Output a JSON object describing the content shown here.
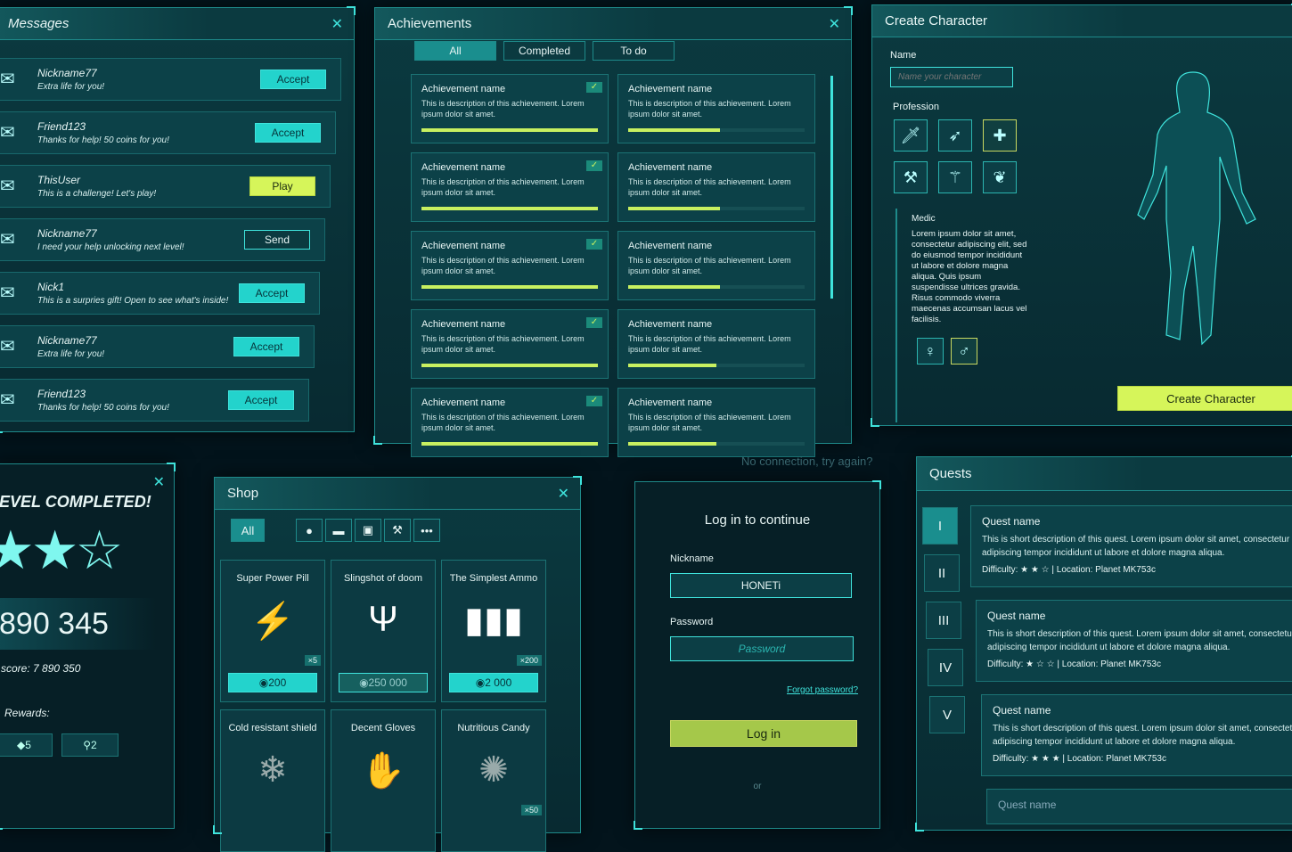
{
  "colors": {
    "accent": "#3fe3dc",
    "lime": "#d6f55a",
    "bg": "#03141c"
  },
  "messages": {
    "title": "Messages",
    "items": [
      {
        "name": "Nickname77",
        "text": "Extra life for you!",
        "button": "Accept",
        "style": "cyan",
        "icon": "heart-envelope-icon"
      },
      {
        "name": "Friend123",
        "text": "Thanks for help! 50 coins for you!",
        "button": "Accept",
        "style": "cyan",
        "icon": "coin-envelope-icon"
      },
      {
        "name": "ThisUser",
        "text": "This is a challenge! Let's play!",
        "button": "Play",
        "style": "lime",
        "icon": "sword-envelope-icon"
      },
      {
        "name": "Nickname77",
        "text": "I need your help unlocking next level!",
        "button": "Send",
        "style": "dark",
        "icon": "envelope-icon"
      },
      {
        "name": "Nick1",
        "text": "This is a surpries gift! Open to see what's inside!",
        "button": "Accept",
        "style": "cyan",
        "icon": "gift-envelope-icon"
      },
      {
        "name": "Nickname77",
        "text": "Extra life for you!",
        "button": "Accept",
        "style": "cyan",
        "icon": "envelope-icon"
      },
      {
        "name": "Friend123",
        "text": "Thanks for help! 50 coins for you!",
        "button": "Accept",
        "style": "cyan",
        "icon": "envelope-icon"
      }
    ]
  },
  "achievements": {
    "title": "Achievements",
    "tabs": [
      "All",
      "Completed",
      "To do"
    ],
    "active_tab": "All",
    "items": [
      {
        "name": "Achievement name",
        "desc": "This is description of this achievement. Lorem ipsum dolor sit amet.",
        "progress": 100,
        "done": true
      },
      {
        "name": "Achievement name",
        "desc": "This is description of this achievement. Lorem ipsum dolor sit amet.",
        "progress": 52,
        "done": false
      },
      {
        "name": "Achievement name",
        "desc": "This is description of this achievement. Lorem ipsum dolor sit amet.",
        "progress": 100,
        "done": true
      },
      {
        "name": "Achievement name",
        "desc": "This is description of this achievement. Lorem ipsum dolor sit amet.",
        "progress": 52,
        "done": false
      },
      {
        "name": "Achievement name",
        "desc": "This is description of this achievement. Lorem ipsum dolor sit amet.",
        "progress": 100,
        "done": true
      },
      {
        "name": "Achievement name",
        "desc": "This is description of this achievement. Lorem ipsum dolor sit amet.",
        "progress": 52,
        "done": false
      },
      {
        "name": "Achievement name",
        "desc": "This is description of this achievement. Lorem ipsum dolor sit amet.",
        "progress": 100,
        "done": true
      },
      {
        "name": "Achievement name",
        "desc": "This is description of this achievement. Lorem ipsum dolor sit amet.",
        "progress": 50,
        "done": false
      },
      {
        "name": "Achievement name",
        "desc": "This is description of this achievement. Lorem ipsum dolor sit amet.",
        "progress": 100,
        "done": true
      },
      {
        "name": "Achievement name",
        "desc": "This is description of this achievement. Lorem ipsum dolor sit amet.",
        "progress": 50,
        "done": false
      }
    ]
  },
  "character": {
    "title": "Create Character",
    "name_label": "Name",
    "name_placeholder": "Name your character",
    "profession_label": "Profession",
    "professions": [
      {
        "icon": "sword-icon",
        "glyph": "🗡"
      },
      {
        "icon": "bow-icon",
        "glyph": "➶"
      },
      {
        "icon": "medic-cross-icon",
        "glyph": "✚",
        "selected": true
      },
      {
        "icon": "hammer-icon",
        "glyph": "⚒"
      },
      {
        "icon": "staff-icon",
        "glyph": "⚚"
      },
      {
        "icon": "leaf-icon",
        "glyph": "❦"
      }
    ],
    "selected_name": "Medic",
    "selected_desc": "Lorem ipsum dolor sit amet, consectetur adipiscing elit, sed do eiusmod tempor incididunt ut labore et dolore magna aliqua. Quis ipsum suspendisse ultrices gravida. Risus commodo viverra maecenas accumsan lacus vel facilisis.",
    "gender": [
      {
        "icon": "female-icon",
        "glyph": "♀"
      },
      {
        "icon": "male-icon",
        "glyph": "♂",
        "selected": true
      }
    ],
    "create_button": "Create Character"
  },
  "level": {
    "title": "EVEL COMPLETED!",
    "stars": 2,
    "stars_total": 3,
    "score": "890 345",
    "best_score": "score: 7 890 350",
    "rewards_label": "Rewards:",
    "rewards": [
      {
        "icon": "gem-icon",
        "value": "5"
      },
      {
        "icon": "key-icon",
        "value": "2"
      }
    ]
  },
  "shop": {
    "title": "Shop",
    "tabs": [
      {
        "label": "All"
      },
      {
        "icon": "apple-icon",
        "glyph": "●"
      },
      {
        "icon": "gun-icon",
        "glyph": "▬"
      },
      {
        "icon": "armor-icon",
        "glyph": "▣"
      },
      {
        "icon": "hammer-icon",
        "glyph": "⚒"
      },
      {
        "icon": "more-icon",
        "glyph": "•••"
      }
    ],
    "items": [
      {
        "name": "Super Power Pill",
        "price": "200",
        "qty": "×5",
        "glyph": "⚡",
        "icon": "power-pill-icon",
        "affordable": true
      },
      {
        "name": "Slingshot of doom",
        "price": "250 000",
        "glyph": "Ψ",
        "icon": "slingshot-icon",
        "affordable": false
      },
      {
        "name": "The Simplest Ammo",
        "price": "2 000",
        "qty": "×200",
        "glyph": "▮▮▮",
        "icon": "ammo-icon",
        "affordable": true
      },
      {
        "name": "Cold resistant shield",
        "glyph": "❄",
        "icon": "shield-icon"
      },
      {
        "name": "Decent Gloves",
        "glyph": "✋",
        "icon": "gloves-icon"
      },
      {
        "name": "Nutritious Candy",
        "glyph": "✺",
        "icon": "candy-icon",
        "qty": "×50"
      }
    ]
  },
  "login": {
    "notice": "No connection, try again?",
    "title": "Log in to continue",
    "nickname_label": "Nickname",
    "nickname_value": "HONETi",
    "password_label": "Password",
    "password_placeholder": "Password",
    "forgot": "Forgot password?",
    "button": "Log in",
    "or": "or"
  },
  "quests": {
    "title": "Quests",
    "tabs": [
      "I",
      "II",
      "III",
      "IV",
      "V"
    ],
    "active_tab": "I",
    "items": [
      {
        "name": "Quest name",
        "desc": "This is short description of this quest. Lorem ipsum dolor sit amet, consectetur adipiscing tempor incididunt ut labore et dolore magna aliqua.",
        "difficulty": 2,
        "difficulty_label": "Difficulty:",
        "location": "Location:  Planet MK753c"
      },
      {
        "name": "Quest name",
        "desc": "This is short description of this quest. Lorem ipsum dolor sit amet, consectetur adipiscing tempor incididunt ut labore et dolore magna aliqua.",
        "difficulty": 1,
        "difficulty_label": "Difficulty:",
        "location": "Location:  Planet MK753c"
      },
      {
        "name": "Quest name",
        "desc": "This is short description of this quest. Lorem ipsum dolor sit amet, consectetur adipiscing tempor incididunt ut labore et dolore magna aliqua.",
        "difficulty": 3,
        "difficulty_label": "Difficulty:",
        "location": "Location:  Planet MK753c"
      },
      {
        "name": "Quest name"
      }
    ]
  }
}
